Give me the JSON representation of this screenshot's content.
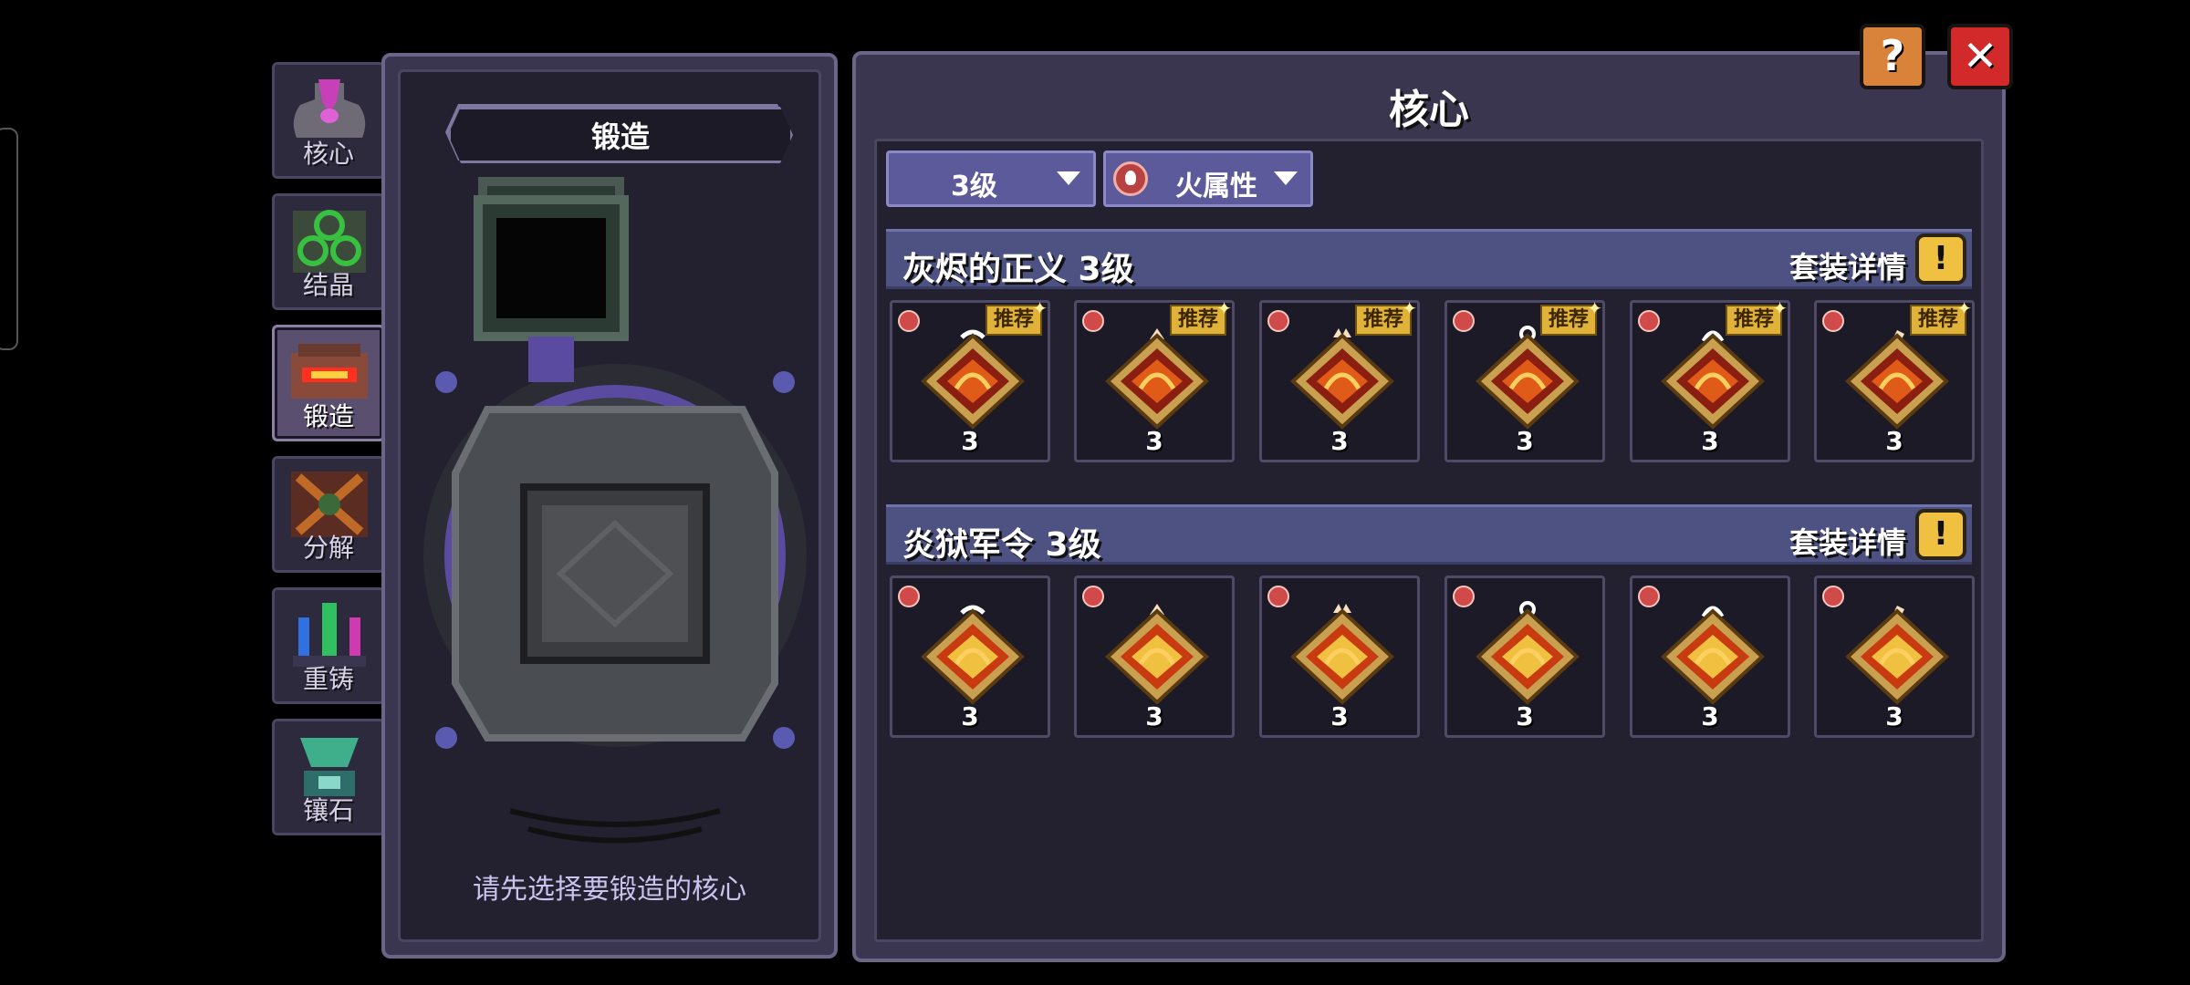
{
  "side_tabs": [
    {
      "label": "核心",
      "active": false
    },
    {
      "label": "结晶",
      "active": false
    },
    {
      "label": "锻造",
      "active": true
    },
    {
      "label": "分解",
      "active": false
    },
    {
      "label": "重铸",
      "active": false
    },
    {
      "label": "镶石",
      "active": false
    }
  ],
  "forge": {
    "title": "锻造",
    "hint": "请先选择要锻造的核心"
  },
  "core_panel": {
    "title": "核心",
    "level_filter": "3级",
    "attribute_filter": "火属性",
    "sets": [
      {
        "name": "灰烬的正义 3级",
        "detail_label": "套装详情",
        "info_glyph": "!",
        "items": [
          {
            "level": "3",
            "badge": "推荐"
          },
          {
            "level": "3",
            "badge": "推荐"
          },
          {
            "level": "3",
            "badge": "推荐"
          },
          {
            "level": "3",
            "badge": "推荐"
          },
          {
            "level": "3",
            "badge": "推荐"
          },
          {
            "level": "3",
            "badge": "推荐"
          }
        ]
      },
      {
        "name": "炎狱军令  3级",
        "detail_label": "套装详情",
        "info_glyph": "!",
        "items": [
          {
            "level": "3",
            "badge": ""
          },
          {
            "level": "3",
            "badge": ""
          },
          {
            "level": "3",
            "badge": ""
          },
          {
            "level": "3",
            "badge": ""
          },
          {
            "level": "3",
            "badge": ""
          },
          {
            "level": "3",
            "badge": ""
          }
        ]
      }
    ]
  },
  "buttons": {
    "help_glyph": "?",
    "close_glyph": "✕"
  },
  "colors": {
    "accent_gold": "#e0b23a",
    "filter_blue": "#5c5a9a",
    "close_red": "#d22a2a",
    "help_orange": "#d9833a"
  },
  "icons": [
    "core-icon",
    "crystal-icon",
    "forge-icon",
    "decompose-icon",
    "reforge-icon",
    "inlay-icon",
    "fire-element-icon",
    "info-icon"
  ]
}
